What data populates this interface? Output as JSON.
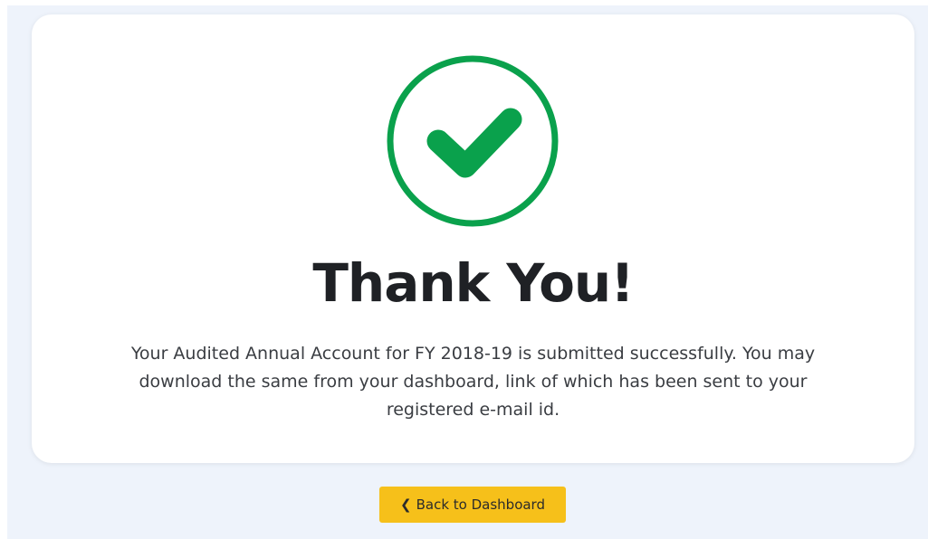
{
  "confirmation": {
    "title": "Thank You!",
    "message": "Your Audited Annual Account for FY 2018-19 is submitted successfully. You may download the same from your dashboard, link of which has been sent to your registered e-mail id."
  },
  "actions": {
    "back_label": "Back to Dashboard",
    "back_icon": "chevron-left-icon"
  },
  "colors": {
    "success": "#0aa14c",
    "button": "#f6c01a"
  }
}
